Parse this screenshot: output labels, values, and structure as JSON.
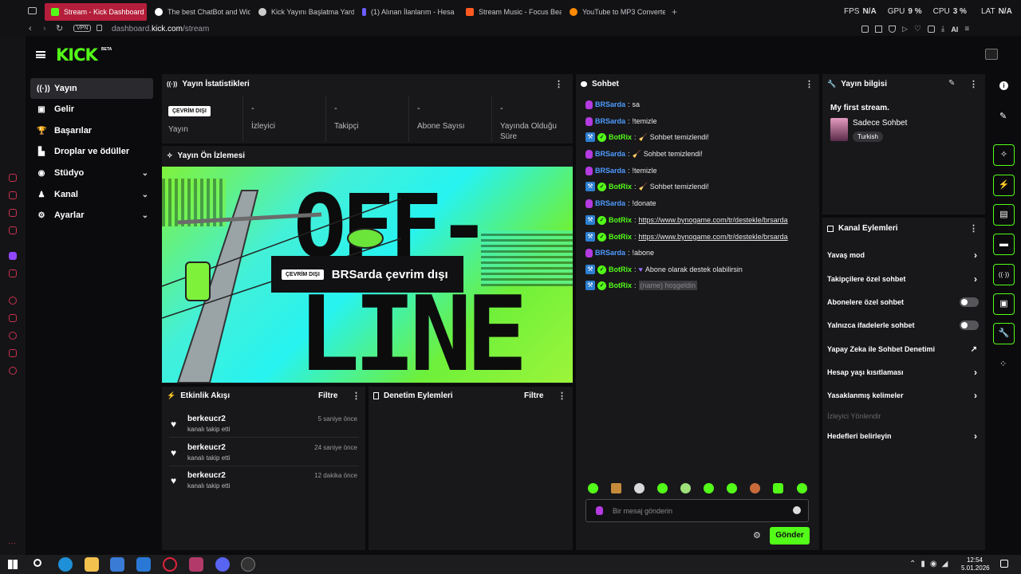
{
  "browser": {
    "tabs": [
      {
        "label": "Stream - Kick Dashboard",
        "color": "#53fc18",
        "active": true
      },
      {
        "label": "The best ChatBot and Wid",
        "color": "#ffffff"
      },
      {
        "label": "Kick Yayını Başlatma Yard",
        "color": "#cccccc"
      },
      {
        "label": "(1) Alınan İlanlarım - Hesa",
        "color": "#6d5dfc"
      },
      {
        "label": "Stream Music - Focus Bea",
        "color": "#ff5a1f"
      },
      {
        "label": "YouTube to MP3 Converte",
        "color": "#ff8a00"
      }
    ],
    "new_tab": "+",
    "hud": {
      "fps_label": "FPS",
      "fps": "N/A",
      "gpu_label": "GPU",
      "gpu": "9 %",
      "cpu_label": "CPU",
      "cpu": "3 %",
      "lat_label": "LAT",
      "lat": "N/A"
    },
    "vpn": "VPN",
    "url_domain": "dashboard.",
    "url_host": "kick.com",
    "url_path": "/stream",
    "ai_label": "AI"
  },
  "kick": {
    "logo": "KICK",
    "beta": "BETA"
  },
  "sidebar": {
    "items": [
      {
        "label": "Yayın",
        "icon": "((·))"
      },
      {
        "label": "Gelir",
        "icon": "▣"
      },
      {
        "label": "Başarılar",
        "icon": "🏆"
      },
      {
        "label": "Droplar ve ödüller",
        "icon": "▙"
      },
      {
        "label": "Stüdyo",
        "icon": "◉"
      },
      {
        "label": "Kanal",
        "icon": "♟"
      },
      {
        "label": "Ayarlar",
        "icon": "⚙"
      }
    ]
  },
  "stats": {
    "title": "Yayın İstatistikleri",
    "offline_badge": "ÇEVRİM DIŞI",
    "status_label": "Yayın",
    "items": [
      {
        "value": "-",
        "label": "İzleyici"
      },
      {
        "value": "-",
        "label": "Takipçi"
      },
      {
        "value": "-",
        "label": "Abone Sayısı"
      },
      {
        "value": "-",
        "label": "Yayında Olduğu Süre"
      }
    ]
  },
  "preview": {
    "title": "Yayın Ön İzlemesi",
    "big_text_1": "OFF-",
    "big_text_2": "LINE",
    "badge": "ÇEVRİM DIŞI",
    "status_text": "BRSarda çevrim dışı"
  },
  "activity": {
    "title": "Etkinlik Akışı",
    "filter": "Filtre",
    "events": [
      {
        "user": "berkeucr2",
        "action": "kanalı takip etti",
        "time": "5 saniye önce"
      },
      {
        "user": "berkeucr2",
        "action": "kanalı takip etti",
        "time": "24 saniye önce"
      },
      {
        "user": "berkeucr2",
        "action": "kanalı takip etti",
        "time": "12 dakika önce"
      }
    ]
  },
  "moderation": {
    "title": "Denetim Eylemleri",
    "filter": "Filtre"
  },
  "chat": {
    "title": "Sohbet",
    "messages": [
      {
        "user": "BRSarda",
        "type": "user",
        "text": "sa"
      },
      {
        "user": "BRSarda",
        "type": "user",
        "text": "!temizle"
      },
      {
        "user": "BotRix",
        "type": "bot",
        "text": "Sohbet temizlendi!"
      },
      {
        "user": "BRSarda",
        "type": "user",
        "text": "Sohbet temizlendi!"
      },
      {
        "user": "BRSarda",
        "type": "user",
        "text": "!temizle"
      },
      {
        "user": "BotRix",
        "type": "bot",
        "text": "Sohbet temizlendi!"
      },
      {
        "user": "BRSarda",
        "type": "user",
        "text": "!donate"
      },
      {
        "user": "BotRix",
        "type": "bot",
        "text": "https://www.bynogame.com/tr/destekle/brsarda",
        "link": true
      },
      {
        "user": "BotRix",
        "type": "bot",
        "text": "https://www.bynogame.com/tr/destekle/brsarda",
        "link": true
      },
      {
        "user": "BRSarda",
        "type": "user",
        "text": "!abone"
      },
      {
        "user": "BotRix",
        "type": "bot",
        "text": "Abone olarak destek olabilirsin",
        "heart": true
      },
      {
        "user": "BotRix",
        "type": "bot",
        "text": "(name) hoşgeldin",
        "highlight": true
      }
    ],
    "input_placeholder": "Bir mesaj gönderin",
    "send": "Gönder"
  },
  "stream_info": {
    "title": "Yayın bilgisi",
    "stream_title": "My first stream.",
    "category": "Sadece Sohbet",
    "tag": "Turkish"
  },
  "channel_actions": {
    "title": "Kanal Eylemleri",
    "items": [
      {
        "label": "Yavaş mod",
        "control": "chevron"
      },
      {
        "label": "Takipçilere özel sohbet",
        "control": "chevron"
      },
      {
        "label": "Abonelere özel sohbet",
        "control": "toggle"
      },
      {
        "label": "Yalnızca ifadelerle sohbet",
        "control": "toggle"
      },
      {
        "label": "Yapay Zeka ile Sohbet Denetimi",
        "control": "external"
      },
      {
        "label": "Hesap yaşı kısıtlaması",
        "control": "chevron"
      },
      {
        "label": "Yasaklanmış kelimeler",
        "control": "chevron"
      },
      {
        "label": "İzleyici Yönlendir",
        "control": "disabled"
      },
      {
        "label": "Hedefleri belirleyin",
        "control": "chevron"
      }
    ]
  },
  "taskbar": {
    "time": "12:54",
    "date": "5.01.2026"
  },
  "colors": {
    "accent": "#53fc18",
    "panel": "#18181b",
    "bg": "#0b0b0d",
    "opera": "#c9334d",
    "user": "#4e9bff"
  }
}
